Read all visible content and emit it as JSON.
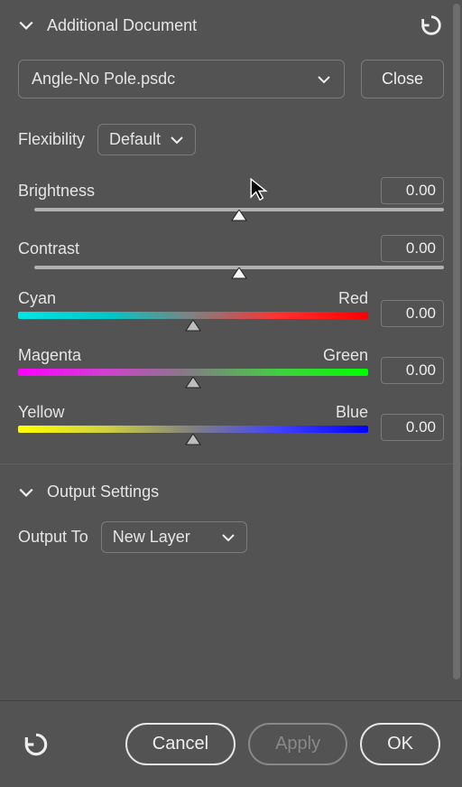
{
  "section_additional": {
    "title": "Additional Document",
    "document": "Angle-No Pole.psdc",
    "close_label": "Close",
    "flexibility_label": "Flexibility",
    "flexibility_value": "Default",
    "brightness_label": "Brightness",
    "brightness_value": "0.00",
    "contrast_label": "Contrast",
    "contrast_value": "0.00",
    "color_sliders": [
      {
        "left": "Cyan",
        "right": "Red",
        "value": "0.00"
      },
      {
        "left": "Magenta",
        "right": "Green",
        "value": "0.00"
      },
      {
        "left": "Yellow",
        "right": "Blue",
        "value": "0.00"
      }
    ]
  },
  "section_output": {
    "title": "Output Settings",
    "output_to_label": "Output To",
    "output_to_value": "New Layer"
  },
  "footer": {
    "cancel": "Cancel",
    "apply": "Apply",
    "ok": "OK"
  }
}
